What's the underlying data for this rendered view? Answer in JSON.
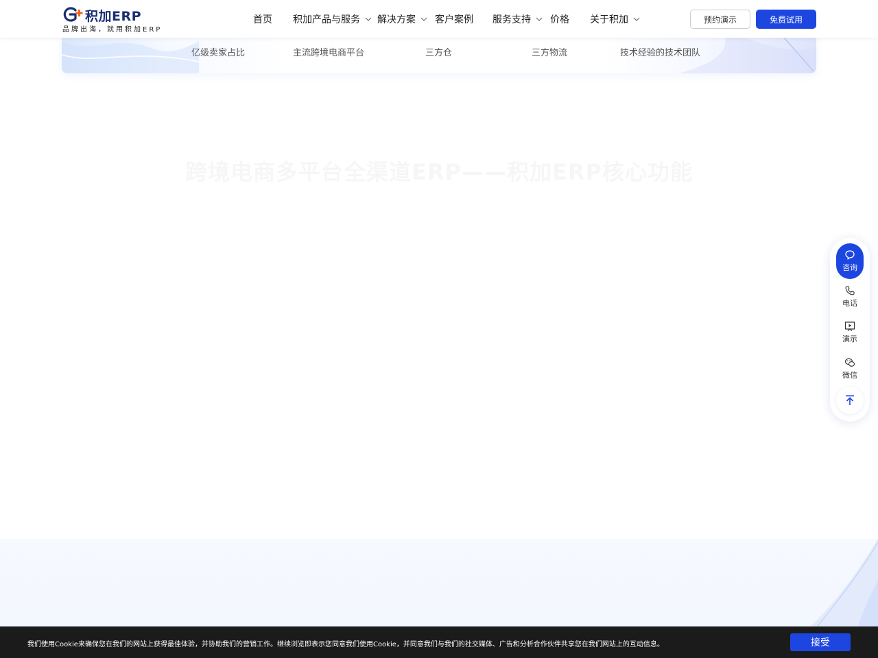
{
  "brand": {
    "name": "积加ERP",
    "slogan": "品牌出海，就用积加ERP",
    "primary_color": "#1d46e0",
    "logo_icon": "gplus-logo-icon"
  },
  "nav": {
    "items": [
      {
        "label": "首页",
        "has_dropdown": false
      },
      {
        "label": "积加产品与服务",
        "has_dropdown": true
      },
      {
        "label": "解决方案",
        "has_dropdown": true
      },
      {
        "label": "客户案例",
        "has_dropdown": false
      },
      {
        "label": "服务支持",
        "has_dropdown": true
      },
      {
        "label": "价格",
        "has_dropdown": false
      },
      {
        "label": "关于积加",
        "has_dropdown": true
      }
    ],
    "demo_button": "预约演示",
    "trial_button": "免费试用"
  },
  "stats": {
    "items": [
      {
        "label": "亿级卖家占比"
      },
      {
        "label": "主流跨境电商平台"
      },
      {
        "label": "三方仓"
      },
      {
        "label": "三方物流"
      },
      {
        "label": "技术经验的技术团队"
      }
    ]
  },
  "section": {
    "title": "跨境电商多平台全渠道ERP——积加ERP核心功能"
  },
  "float_bar": {
    "consult": "咨询",
    "phone": "电话",
    "demo": "演示",
    "wechat": "微信",
    "icons": [
      "chat-bubble-icon",
      "phone-icon",
      "play-screen-icon",
      "wechat-icon",
      "back-to-top-icon"
    ]
  },
  "cookie": {
    "text": "我们使用Cookie来确保您在我们的网站上获得最佳体验，并协助我们的营销工作。继续浏览即表示您同意我们使用Cookie，并同意我们与我们的社交媒体、广告和分析合作伙伴共享您在我们网站上的互动信息。",
    "accept": "接受"
  }
}
